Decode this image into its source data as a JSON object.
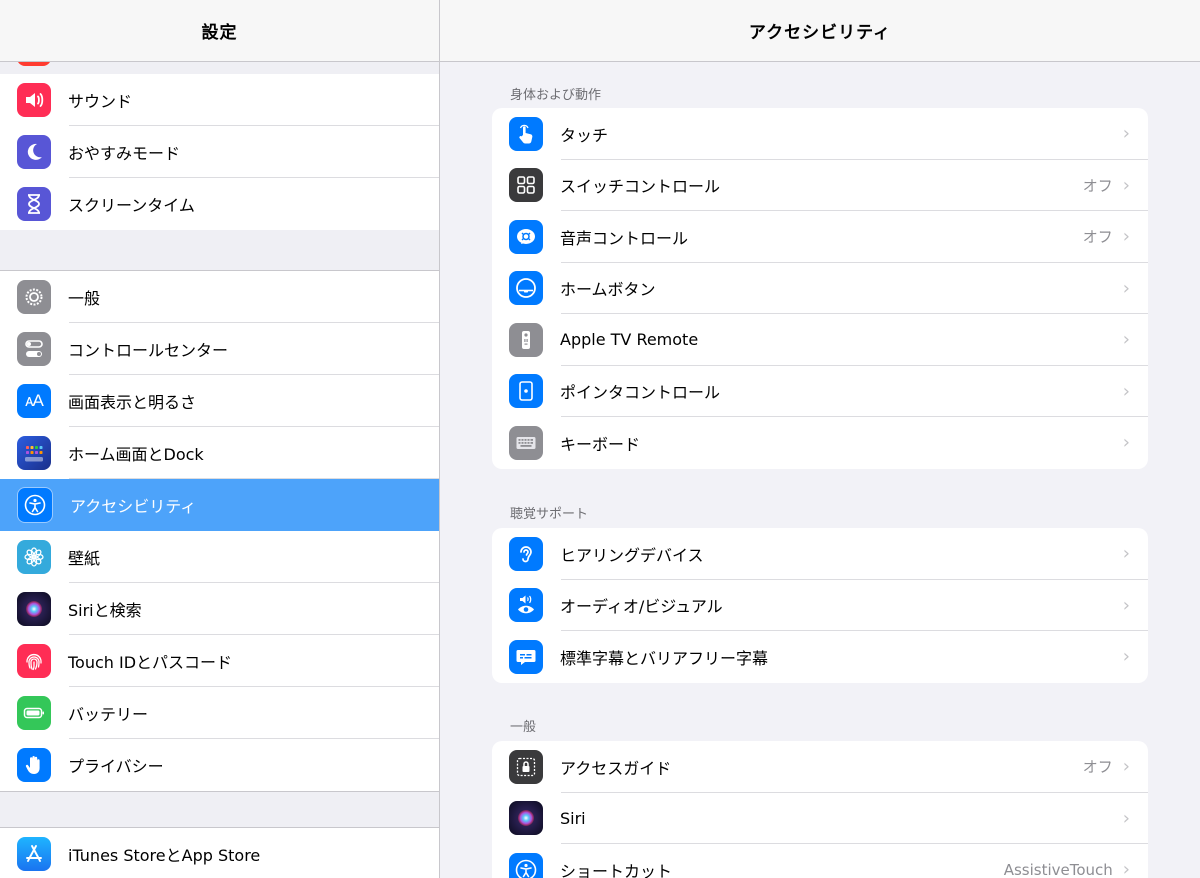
{
  "sidebar": {
    "title": "設定",
    "groups": [
      {
        "items": [
          {
            "label": "サウンド",
            "icon": "sound-icon",
            "color": "#ff2d55"
          },
          {
            "label": "おやすみモード",
            "icon": "moon-icon",
            "color": "#5856d6"
          },
          {
            "label": "スクリーンタイム",
            "icon": "hourglass-icon",
            "color": "#5856d6"
          }
        ]
      },
      {
        "items": [
          {
            "label": "一般",
            "icon": "gear-icon",
            "color": "#8e8e93"
          },
          {
            "label": "コントロールセンター",
            "icon": "toggles-icon",
            "color": "#8e8e93"
          },
          {
            "label": "画面表示と明るさ",
            "icon": "text-size-icon",
            "color": "#007aff"
          },
          {
            "label": "ホーム画面とDock",
            "icon": "home-grid-icon",
            "color": "#1e3fa8"
          },
          {
            "label": "アクセシビリティ",
            "icon": "accessibility-icon",
            "color": "#007aff",
            "selected": true
          },
          {
            "label": "壁紙",
            "icon": "flower-icon",
            "color": "#34aadc"
          },
          {
            "label": "Siriと検索",
            "icon": "siri-icon",
            "color": "#1c1c3a"
          },
          {
            "label": "Touch IDとパスコード",
            "icon": "fingerprint-icon",
            "color": "#ff2d55"
          },
          {
            "label": "バッテリー",
            "icon": "battery-icon",
            "color": "#34c759"
          },
          {
            "label": "プライバシー",
            "icon": "hand-icon",
            "color": "#007aff"
          }
        ]
      },
      {
        "items": [
          {
            "label": "iTunes StoreとApp Store",
            "icon": "app-store-icon",
            "color": "#1a8cff"
          }
        ]
      }
    ]
  },
  "main": {
    "title": "アクセシビリティ",
    "sections": [
      {
        "title": "身体および動作",
        "rows": [
          {
            "label": "タッチ",
            "value": "",
            "icon": "touch-hand-icon",
            "color": "#007aff"
          },
          {
            "label": "スイッチコントロール",
            "value": "オフ",
            "icon": "switch-grid-icon",
            "color": "#3a3a3c"
          },
          {
            "label": "音声コントロール",
            "value": "オフ",
            "icon": "voice-control-icon",
            "color": "#007aff"
          },
          {
            "label": "ホームボタン",
            "value": "",
            "icon": "home-button-icon",
            "color": "#007aff"
          },
          {
            "label": "Apple TV Remote",
            "value": "",
            "icon": "remote-icon",
            "color": "#8e8e93"
          },
          {
            "label": "ポインタコントロール",
            "value": "",
            "icon": "pointer-icon",
            "color": "#007aff"
          },
          {
            "label": "キーボード",
            "value": "",
            "icon": "keyboard-icon",
            "color": "#8e8e93"
          }
        ]
      },
      {
        "title": "聴覚サポート",
        "rows": [
          {
            "label": "ヒアリングデバイス",
            "value": "",
            "icon": "ear-icon",
            "color": "#007aff"
          },
          {
            "label": "オーディオ/ビジュアル",
            "value": "",
            "icon": "audio-visual-icon",
            "color": "#007aff"
          },
          {
            "label": "標準字幕とバリアフリー字幕",
            "value": "",
            "icon": "captions-icon",
            "color": "#007aff"
          }
        ]
      },
      {
        "title": "一般",
        "rows": [
          {
            "label": "アクセスガイド",
            "value": "オフ",
            "icon": "lock-icon",
            "color": "#3a3a3c"
          },
          {
            "label": "Siri",
            "value": "",
            "icon": "siri-icon",
            "color": "#1c1c3a"
          },
          {
            "label": "ショートカット",
            "value": "AssistiveTouch",
            "icon": "accessibility-icon",
            "color": "#007aff"
          }
        ]
      }
    ]
  }
}
